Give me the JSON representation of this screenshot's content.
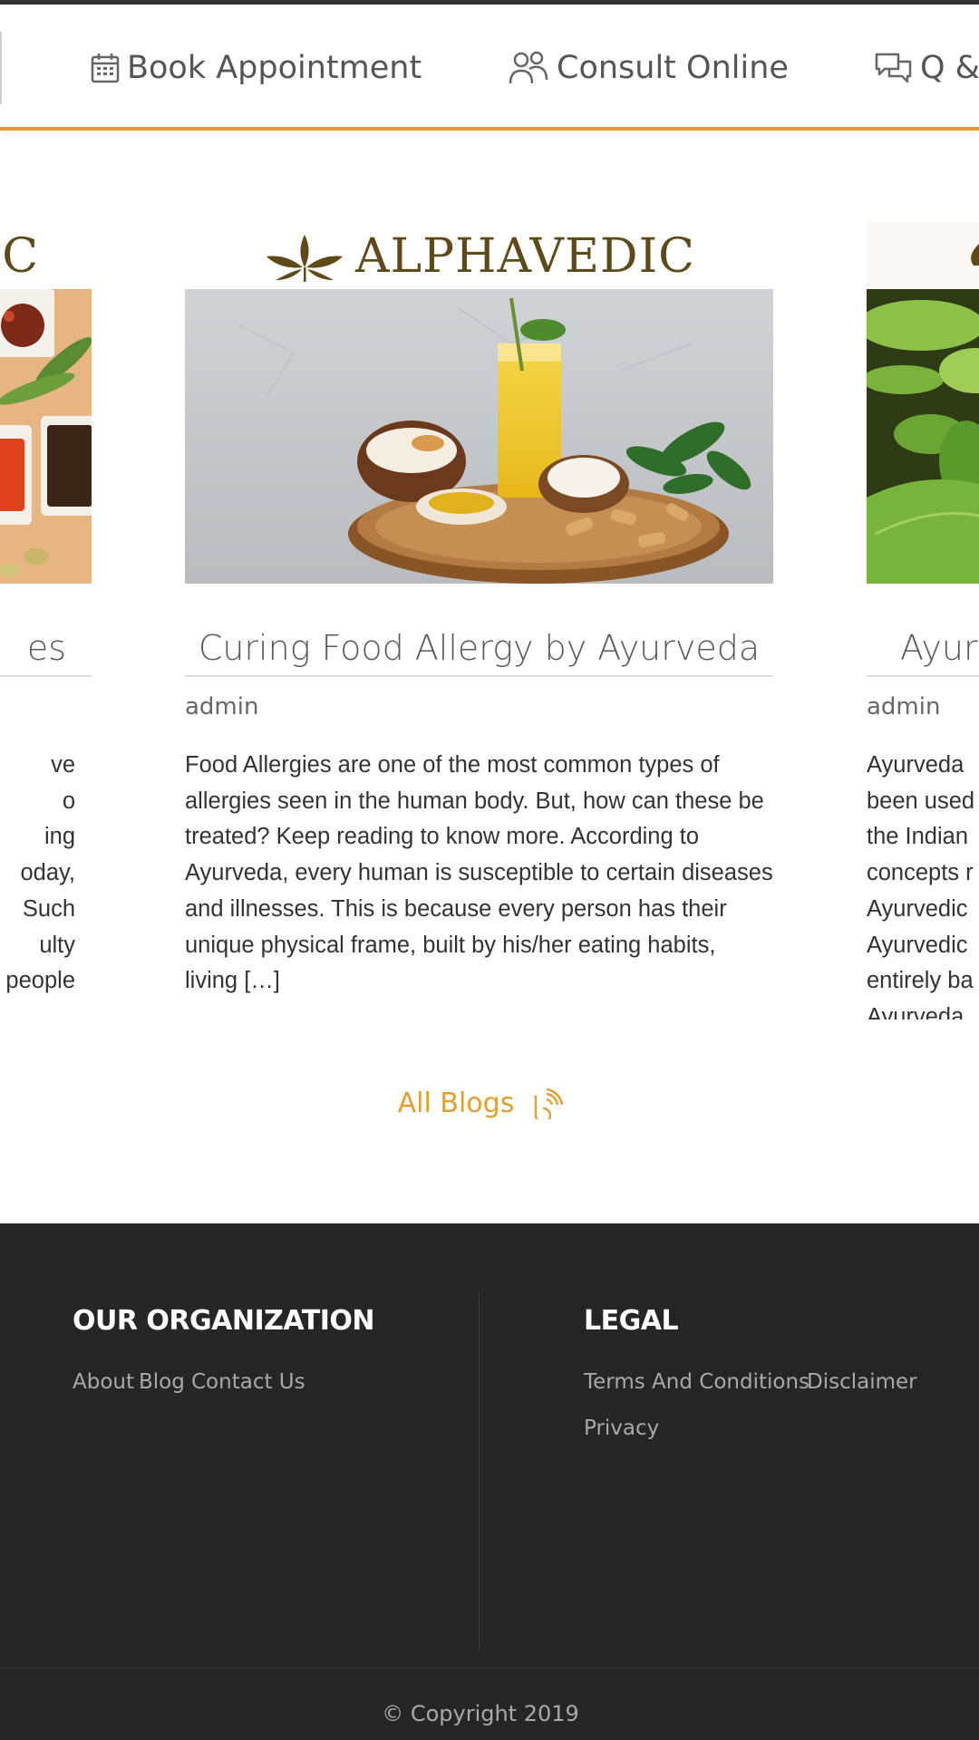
{
  "nav": {
    "items": [
      {
        "label": "Book Appointment",
        "icon": "calendar-icon"
      },
      {
        "label": "Consult Online",
        "icon": "users-icon"
      },
      {
        "label": "Q &",
        "icon": "chat-bubbles-icon"
      }
    ]
  },
  "blog_cards": {
    "left": {
      "logo_fragment": "C",
      "title_fragment": "es",
      "excerpt_lines": [
        "ve",
        "o",
        "ing",
        "oday,",
        "Such",
        "ulty",
        "people"
      ]
    },
    "center": {
      "logo": "ALPHAVEDIC",
      "title": "Curing Food Allergy by Ayurveda",
      "author": "admin",
      "excerpt": "Food Allergies are one of the most common types of allergies seen in the human body. But, how can these be treated? Keep reading to know more. According to Ayurveda, every human is susceptible to certain diseases and illnesses. This is because every person has their unique physical frame, built by his/her eating habits, living […]"
    },
    "right": {
      "title_fragment": "Ayur",
      "author": "admin",
      "excerpt_lines": [
        "Ayurveda",
        "been used",
        "the Indian",
        "concepts r",
        "Ayurvedic",
        "Ayurvedic",
        "entirely ba",
        "Ayurveda"
      ]
    }
  },
  "all_blogs": {
    "label": "All Blogs",
    "icon": "rss-icon"
  },
  "footer": {
    "org": {
      "heading": "OUR ORGANIZATION",
      "links": [
        "About",
        "Blog",
        "Contact Us"
      ]
    },
    "legal": {
      "heading": "LEGAL",
      "links": [
        "Terms And Conditions",
        "Disclaimer",
        "Privacy"
      ]
    },
    "copyright": "© Copyright 2019"
  },
  "colors": {
    "accent": "#e0a030",
    "footer_bg": "#262626",
    "logo": "#5d4a16"
  }
}
